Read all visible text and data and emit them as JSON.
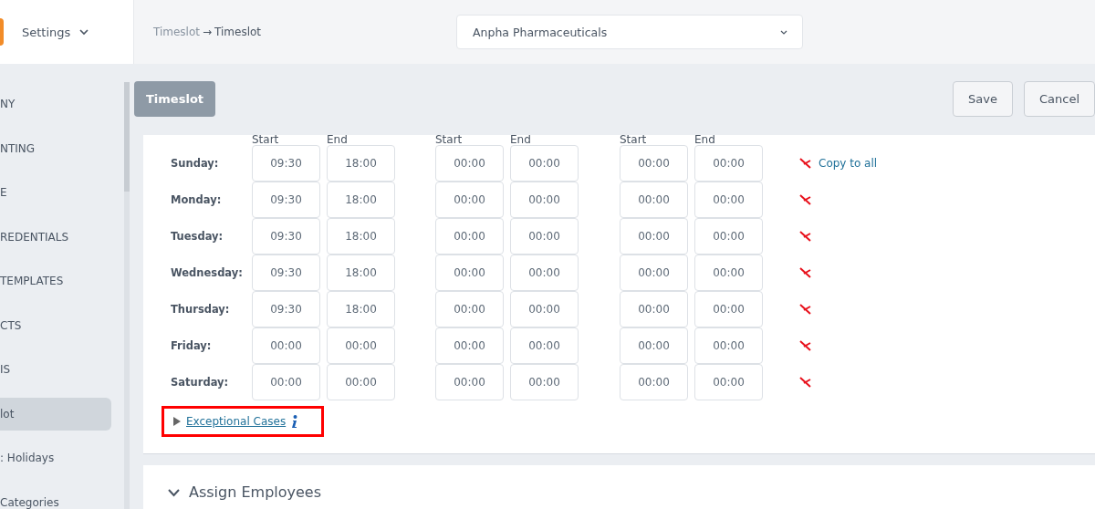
{
  "topbar": {
    "menu": "Settings",
    "breadcrumb": {
      "parent": "Timeslot",
      "arrow": "→",
      "current": "Timeslot"
    },
    "company_select": "Anpha Pharmaceuticals"
  },
  "sidebar": {
    "items": [
      {
        "label": "NY",
        "selected": false
      },
      {
        "label": "NTING",
        "selected": false
      },
      {
        "label": "E",
        "selected": false
      },
      {
        "label": "REDENTIALS",
        "selected": false
      },
      {
        "label": "TEMPLATES",
        "selected": false
      },
      {
        "label": "CTS",
        "selected": false
      },
      {
        "label": "IS",
        "selected": false
      },
      {
        "label": "lot",
        "selected": true
      },
      {
        "label": ": Holidays",
        "selected": false
      },
      {
        "label": "Categories",
        "selected": false
      }
    ]
  },
  "toolbar": {
    "title": "Timeslot",
    "buttons": [
      "Save",
      "Cancel"
    ]
  },
  "schedule": {
    "column_labels": [
      "Start",
      "End",
      "Start",
      "End",
      "Start",
      "End"
    ],
    "copy_link": "Copy to all",
    "days": [
      {
        "day": "Sunday:",
        "times": [
          "09:30",
          "18:00",
          "00:00",
          "00:00",
          "00:00",
          "00:00"
        ]
      },
      {
        "day": "Monday:",
        "times": [
          "09:30",
          "18:00",
          "00:00",
          "00:00",
          "00:00",
          "00:00"
        ]
      },
      {
        "day": "Tuesday:",
        "times": [
          "09:30",
          "18:00",
          "00:00",
          "00:00",
          "00:00",
          "00:00"
        ]
      },
      {
        "day": "Wednesday:",
        "times": [
          "09:30",
          "18:00",
          "00:00",
          "00:00",
          "00:00",
          "00:00"
        ]
      },
      {
        "day": "Thursday:",
        "times": [
          "09:30",
          "18:00",
          "00:00",
          "00:00",
          "00:00",
          "00:00"
        ]
      },
      {
        "day": "Friday:",
        "times": [
          "00:00",
          "00:00",
          "00:00",
          "00:00",
          "00:00",
          "00:00"
        ]
      },
      {
        "day": "Saturday:",
        "times": [
          "00:00",
          "00:00",
          "00:00",
          "00:00",
          "00:00",
          "00:00"
        ]
      }
    ],
    "exceptional": {
      "label": "Exceptional Cases",
      "expanded": false
    }
  },
  "assign_section": {
    "title": "Assign Employees",
    "expanded": true
  }
}
